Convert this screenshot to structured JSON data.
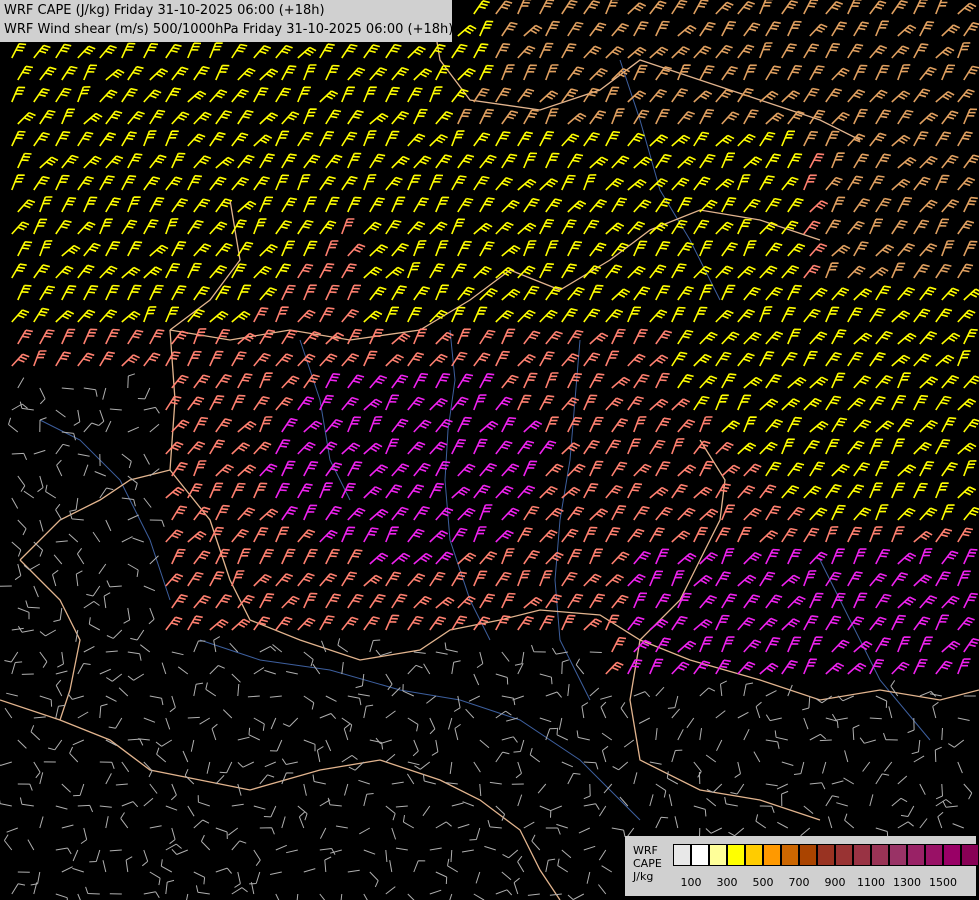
{
  "title": {
    "line1": "WRF CAPE (J/kg) Friday 31-10-2025 06:00 (+18h)",
    "line2": "WRF Wind shear (m/s) 500/1000hPa Friday 31-10-2025 06:00 (+18h)"
  },
  "legend": {
    "label_line1": "WRF",
    "label_line2": "CAPE",
    "label_line3": "J/kg",
    "tick_labels": [
      "100",
      "300",
      "500",
      "700",
      "900",
      "1100",
      "1300",
      "1500"
    ],
    "colors": [
      "#e8e8e8",
      "#ffffff",
      "#ffff99",
      "#ffff00",
      "#ffcc00",
      "#ff9900",
      "#cc6600",
      "#aa4400",
      "#993322",
      "#993333",
      "#993344",
      "#993355",
      "#993366",
      "#992266",
      "#991166",
      "#990066",
      "#880055"
    ]
  },
  "map_colors": {
    "background": "#000000",
    "border": "#e0b090",
    "river": "#4466aa",
    "barb_gray": "#b0b0b0",
    "barb_salmon": "#ff8070",
    "barb_magenta": "#ee22ee",
    "barb_yellow": "#ffff00",
    "barb_tan": "#e0a060"
  }
}
